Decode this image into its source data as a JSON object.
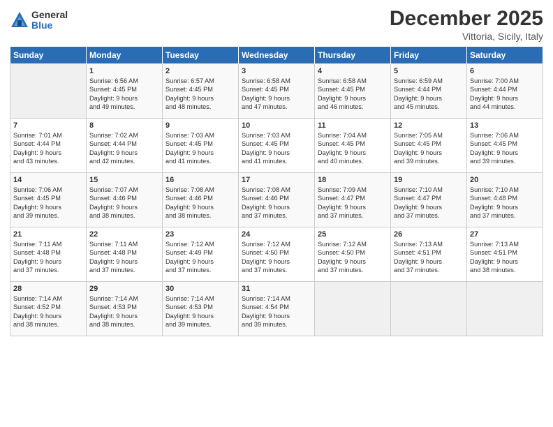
{
  "logo": {
    "general": "General",
    "blue": "Blue"
  },
  "header": {
    "month": "December 2025",
    "location": "Vittoria, Sicily, Italy"
  },
  "weekdays": [
    "Sunday",
    "Monday",
    "Tuesday",
    "Wednesday",
    "Thursday",
    "Friday",
    "Saturday"
  ],
  "weeks": [
    [
      {
        "day": "",
        "info": ""
      },
      {
        "day": "1",
        "info": "Sunrise: 6:56 AM\nSunset: 4:45 PM\nDaylight: 9 hours\nand 49 minutes."
      },
      {
        "day": "2",
        "info": "Sunrise: 6:57 AM\nSunset: 4:45 PM\nDaylight: 9 hours\nand 48 minutes."
      },
      {
        "day": "3",
        "info": "Sunrise: 6:58 AM\nSunset: 4:45 PM\nDaylight: 9 hours\nand 47 minutes."
      },
      {
        "day": "4",
        "info": "Sunrise: 6:58 AM\nSunset: 4:45 PM\nDaylight: 9 hours\nand 46 minutes."
      },
      {
        "day": "5",
        "info": "Sunrise: 6:59 AM\nSunset: 4:44 PM\nDaylight: 9 hours\nand 45 minutes."
      },
      {
        "day": "6",
        "info": "Sunrise: 7:00 AM\nSunset: 4:44 PM\nDaylight: 9 hours\nand 44 minutes."
      }
    ],
    [
      {
        "day": "7",
        "info": "Sunrise: 7:01 AM\nSunset: 4:44 PM\nDaylight: 9 hours\nand 43 minutes."
      },
      {
        "day": "8",
        "info": "Sunrise: 7:02 AM\nSunset: 4:44 PM\nDaylight: 9 hours\nand 42 minutes."
      },
      {
        "day": "9",
        "info": "Sunrise: 7:03 AM\nSunset: 4:45 PM\nDaylight: 9 hours\nand 41 minutes."
      },
      {
        "day": "10",
        "info": "Sunrise: 7:03 AM\nSunset: 4:45 PM\nDaylight: 9 hours\nand 41 minutes."
      },
      {
        "day": "11",
        "info": "Sunrise: 7:04 AM\nSunset: 4:45 PM\nDaylight: 9 hours\nand 40 minutes."
      },
      {
        "day": "12",
        "info": "Sunrise: 7:05 AM\nSunset: 4:45 PM\nDaylight: 9 hours\nand 39 minutes."
      },
      {
        "day": "13",
        "info": "Sunrise: 7:06 AM\nSunset: 4:45 PM\nDaylight: 9 hours\nand 39 minutes."
      }
    ],
    [
      {
        "day": "14",
        "info": "Sunrise: 7:06 AM\nSunset: 4:45 PM\nDaylight: 9 hours\nand 39 minutes."
      },
      {
        "day": "15",
        "info": "Sunrise: 7:07 AM\nSunset: 4:46 PM\nDaylight: 9 hours\nand 38 minutes."
      },
      {
        "day": "16",
        "info": "Sunrise: 7:08 AM\nSunset: 4:46 PM\nDaylight: 9 hours\nand 38 minutes."
      },
      {
        "day": "17",
        "info": "Sunrise: 7:08 AM\nSunset: 4:46 PM\nDaylight: 9 hours\nand 37 minutes."
      },
      {
        "day": "18",
        "info": "Sunrise: 7:09 AM\nSunset: 4:47 PM\nDaylight: 9 hours\nand 37 minutes."
      },
      {
        "day": "19",
        "info": "Sunrise: 7:10 AM\nSunset: 4:47 PM\nDaylight: 9 hours\nand 37 minutes."
      },
      {
        "day": "20",
        "info": "Sunrise: 7:10 AM\nSunset: 4:48 PM\nDaylight: 9 hours\nand 37 minutes."
      }
    ],
    [
      {
        "day": "21",
        "info": "Sunrise: 7:11 AM\nSunset: 4:48 PM\nDaylight: 9 hours\nand 37 minutes."
      },
      {
        "day": "22",
        "info": "Sunrise: 7:11 AM\nSunset: 4:48 PM\nDaylight: 9 hours\nand 37 minutes."
      },
      {
        "day": "23",
        "info": "Sunrise: 7:12 AM\nSunset: 4:49 PM\nDaylight: 9 hours\nand 37 minutes."
      },
      {
        "day": "24",
        "info": "Sunrise: 7:12 AM\nSunset: 4:50 PM\nDaylight: 9 hours\nand 37 minutes."
      },
      {
        "day": "25",
        "info": "Sunrise: 7:12 AM\nSunset: 4:50 PM\nDaylight: 9 hours\nand 37 minutes."
      },
      {
        "day": "26",
        "info": "Sunrise: 7:13 AM\nSunset: 4:51 PM\nDaylight: 9 hours\nand 37 minutes."
      },
      {
        "day": "27",
        "info": "Sunrise: 7:13 AM\nSunset: 4:51 PM\nDaylight: 9 hours\nand 38 minutes."
      }
    ],
    [
      {
        "day": "28",
        "info": "Sunrise: 7:14 AM\nSunset: 4:52 PM\nDaylight: 9 hours\nand 38 minutes."
      },
      {
        "day": "29",
        "info": "Sunrise: 7:14 AM\nSunset: 4:53 PM\nDaylight: 9 hours\nand 38 minutes."
      },
      {
        "day": "30",
        "info": "Sunrise: 7:14 AM\nSunset: 4:53 PM\nDaylight: 9 hours\nand 39 minutes."
      },
      {
        "day": "31",
        "info": "Sunrise: 7:14 AM\nSunset: 4:54 PM\nDaylight: 9 hours\nand 39 minutes."
      },
      {
        "day": "",
        "info": ""
      },
      {
        "day": "",
        "info": ""
      },
      {
        "day": "",
        "info": ""
      }
    ]
  ]
}
